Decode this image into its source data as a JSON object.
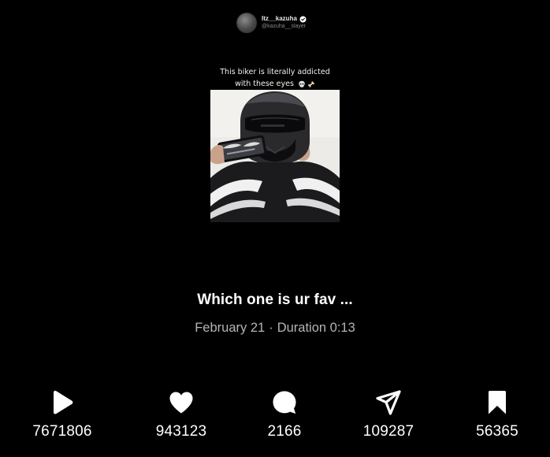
{
  "profile": {
    "name": "Itz__kazuha",
    "handle": "@kazuha__slayer"
  },
  "overlay_caption": {
    "line1": "This biker is literally addicted",
    "line2": "with these eyes"
  },
  "post": {
    "title": "Which one is ur fav ...",
    "date": "February 21",
    "separator": "·",
    "duration": "Duration 0:13"
  },
  "actions": [
    {
      "name": "plays",
      "icon": "play-icon",
      "count": "7671806"
    },
    {
      "name": "likes",
      "icon": "heart-icon",
      "count": "943123"
    },
    {
      "name": "comments",
      "icon": "comment-icon",
      "count": "2166"
    },
    {
      "name": "shares",
      "icon": "send-icon",
      "count": "109287"
    },
    {
      "name": "saves",
      "icon": "bookmark-icon",
      "count": "56365"
    }
  ],
  "colors": {
    "background": "#000000",
    "text_primary": "#ffffff",
    "text_secondary": "#b5b5b5",
    "verified_badge": "#ffffff"
  }
}
